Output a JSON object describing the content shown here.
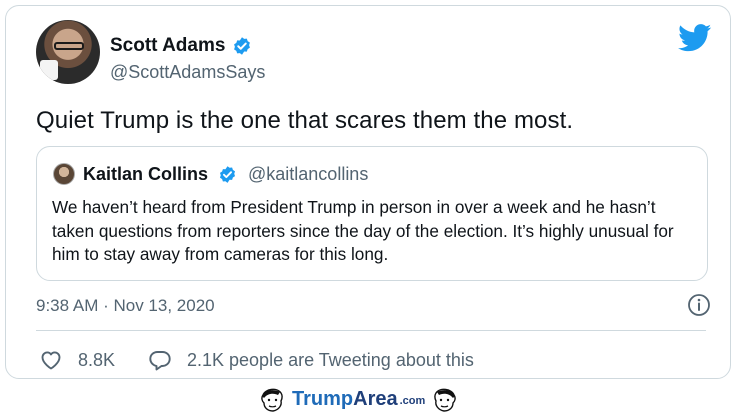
{
  "tweet": {
    "author": {
      "name": "Scott Adams",
      "handle": "@ScottAdamsSays",
      "verified": true
    },
    "text": "Quiet Trump is the one that scares them the most.",
    "quoted": {
      "author": {
        "name": "Kaitlan Collins",
        "handle": "@kaitlancollins",
        "verified": true
      },
      "text": "We haven’t heard from President Trump in person in over a week and he hasn’t taken questions from reporters since the day of the election. It’s highly unusual for him to stay away from cameras for this long."
    },
    "timestamp": "9:38 AM · Nov 13, 2020",
    "likes": "8.8K",
    "conversation": "2.1K people are Tweeting about this"
  },
  "watermark": {
    "part1": "Trump",
    "part2": "Area",
    "part3": ".com"
  },
  "icons": {
    "verified": "verified-badge-icon",
    "brand": "twitter-bird-icon",
    "info": "info-icon",
    "like": "heart-icon",
    "reply": "speech-bubble-icon",
    "watermark_face": "caricature-face-icon"
  },
  "colors": {
    "verified": "#1d9bf0",
    "twitter": "#1d9bf0",
    "secondary_text": "#536471",
    "border": "#cfd9de",
    "brand_blue": "#1f6bb8"
  }
}
